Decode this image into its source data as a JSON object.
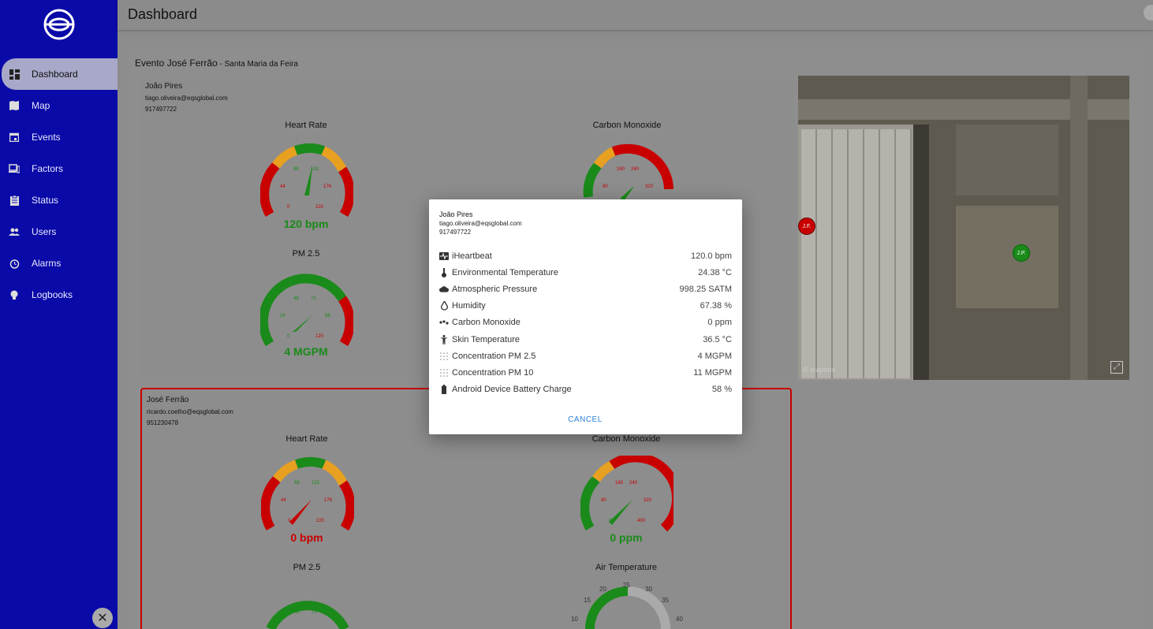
{
  "topbar": {
    "title": "Dashboard"
  },
  "sidebar": {
    "items": [
      {
        "label": "Dashboard",
        "icon": "dashboard-icon",
        "active": true
      },
      {
        "label": "Map",
        "icon": "map-icon"
      },
      {
        "label": "Events",
        "icon": "calendar-icon"
      },
      {
        "label": "Factors",
        "icon": "devices-icon"
      },
      {
        "label": "Status",
        "icon": "clipboard-icon"
      },
      {
        "label": "Users",
        "icon": "users-icon"
      },
      {
        "label": "Alarms",
        "icon": "alarm-icon"
      },
      {
        "label": "Logbooks",
        "icon": "lightbulb-icon"
      }
    ],
    "close_label": "✕"
  },
  "event": {
    "title": "Evento José Ferrão",
    "location": " - Santa Maria da Feira"
  },
  "person1": {
    "name": "João Pires",
    "email": "tiago.oliveira@eqsglobal.com",
    "phone": "917497722",
    "heart_rate": {
      "title": "Heart Rate",
      "value_label": "120 bpm",
      "value": 120,
      "ticks": [
        "0",
        "44",
        "88",
        "132",
        "176",
        "220"
      ]
    },
    "co": {
      "title": "Carbon Monoxide",
      "ticks": [
        "80",
        "160",
        "240",
        "320"
      ]
    },
    "pm25": {
      "title": "PM 2.5",
      "value_label": "4 MGPM",
      "value": 4,
      "ticks": [
        "0",
        "24",
        "48",
        "72",
        "96",
        "120"
      ]
    }
  },
  "person2": {
    "name": "José Ferrão",
    "email": "ricardo.coelho@eqsglobal.com",
    "phone": "951230478",
    "heart_rate": {
      "title": "Heart Rate",
      "value_label": "0 bpm",
      "value": 0,
      "ticks": [
        "0",
        "44",
        "88",
        "132",
        "176",
        "220"
      ]
    },
    "co": {
      "title": "Carbon Monoxide",
      "value_label": "0 ppm",
      "value": 0,
      "ticks": [
        "0",
        "80",
        "160",
        "240",
        "320",
        "400"
      ]
    },
    "pm25": {
      "title": "PM 2.5",
      "ticks": [
        "48",
        "72"
      ]
    },
    "air_temp": {
      "title": "Air Temperature",
      "ticks": [
        "10",
        "15",
        "20",
        "25",
        "30",
        "35",
        "40"
      ]
    }
  },
  "map": {
    "markers": [
      {
        "label": "J.F.",
        "color": "#c80000"
      },
      {
        "label": "J.P.",
        "color": "#1a8a1a"
      }
    ],
    "attribution": "© mapbox"
  },
  "dialog": {
    "name": "João Pires",
    "email": "tiago.oliveira@eqsglobal.com",
    "phone": "917497722",
    "rows": [
      {
        "icon": "heartbeat-icon",
        "label": "iHeartbeat",
        "value": "120.0 bpm"
      },
      {
        "icon": "thermometer-icon",
        "label": "Environmental Temperature",
        "value": "24.38 °C"
      },
      {
        "icon": "cloud-icon",
        "label": "Atmospheric Pressure",
        "value": "998.25 SATM"
      },
      {
        "icon": "drop-icon",
        "label": "Humidity",
        "value": "67.38 %"
      },
      {
        "icon": "molecule-icon",
        "label": "Carbon Monoxide",
        "value": "0 ppm"
      },
      {
        "icon": "person-icon",
        "label": "Skin Temperature",
        "value": "36.5 °C"
      },
      {
        "icon": "particles-icon",
        "label": "Concentration PM 2.5",
        "value": "4 MGPM"
      },
      {
        "icon": "particles-icon",
        "label": "Concentration PM 10",
        "value": "11 MGPM"
      },
      {
        "icon": "battery-icon",
        "label": "Android Device Battery Charge",
        "value": "58 %"
      }
    ],
    "cancel_label": "CANCEL"
  },
  "colors": {
    "sidebar": "#0a0aa8",
    "danger": "#c80000",
    "ok": "#1a8a1a",
    "warn": "#e8a020",
    "link": "#2a7fd4"
  }
}
